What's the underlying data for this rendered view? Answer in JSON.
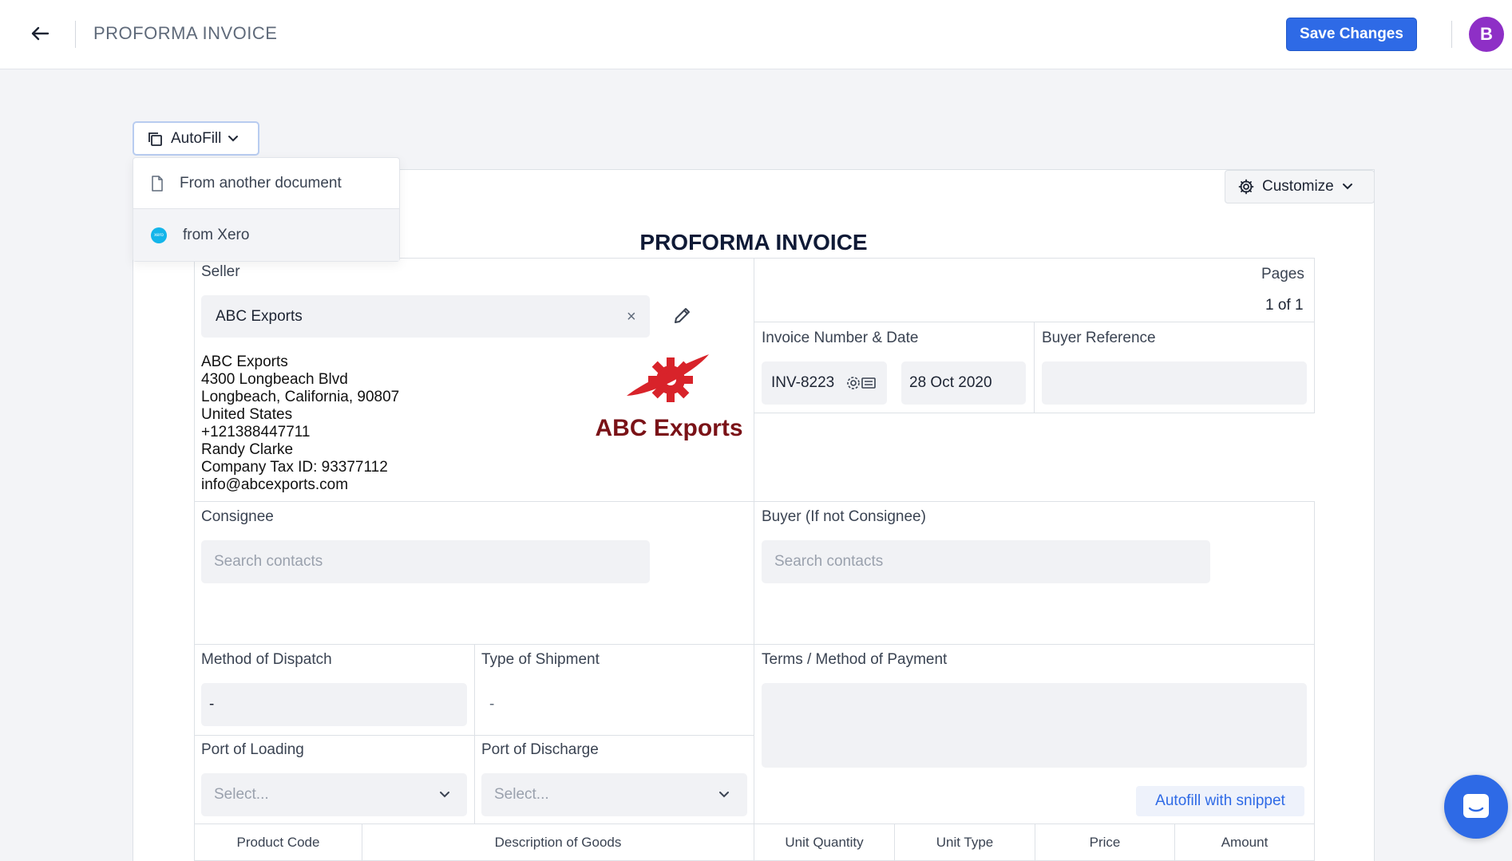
{
  "header": {
    "title": "PROFORMA INVOICE",
    "save_label": "Save Changes",
    "avatar_initial": "B",
    "back_icon": "arrow-left-icon"
  },
  "autofill": {
    "label": "AutoFill",
    "items": [
      {
        "label": "From another document",
        "icon": "document-icon"
      },
      {
        "label": "from Xero",
        "icon": "xero-icon",
        "icon_text": "xero"
      }
    ]
  },
  "customize": {
    "label": "Customize"
  },
  "document": {
    "title": "PROFORMA INVOICE",
    "seller": {
      "label": "Seller",
      "selected": "ABC Exports",
      "clear_symbol": "×",
      "lines": [
        "ABC Exports",
        "4300 Longbeach Blvd",
        "Longbeach, California, 90807",
        "United States",
        "+121388447711",
        "Randy Clarke",
        "Company Tax ID: 93377112",
        "info@abcexports.com"
      ],
      "logo_text": "ABC Exports"
    },
    "pages": {
      "label": "Pages",
      "value": "1 of 1"
    },
    "invoice": {
      "label": "Invoice Number & Date",
      "number": "INV-8223",
      "date": "28 Oct 2020"
    },
    "buyer_reference": {
      "label": "Buyer Reference",
      "value": ""
    },
    "consignee": {
      "label": "Consignee",
      "placeholder": "Search contacts"
    },
    "buyer": {
      "label": "Buyer (If not Consignee)",
      "placeholder": "Search contacts"
    },
    "dispatch": {
      "label": "Method of Dispatch",
      "value": "-"
    },
    "shipment": {
      "label": "Type of Shipment",
      "value": "-"
    },
    "terms": {
      "label": "Terms / Method of Payment",
      "value": ""
    },
    "port_loading": {
      "label": "Port of Loading",
      "placeholder": "Select..."
    },
    "port_discharge": {
      "label": "Port of Discharge",
      "placeholder": "Select..."
    },
    "autofill_snippet": "Autofill with snippet",
    "table_headers": [
      "Product Code",
      "Description of Goods",
      "Unit Quantity",
      "Unit Type",
      "Price",
      "Amount"
    ]
  },
  "colors": {
    "primary": "#2e6ae6",
    "avatar": "#8e2fc6",
    "xero": "#13b5ea",
    "logo_red": "#d8232a",
    "logo_text": "#7a1217"
  }
}
